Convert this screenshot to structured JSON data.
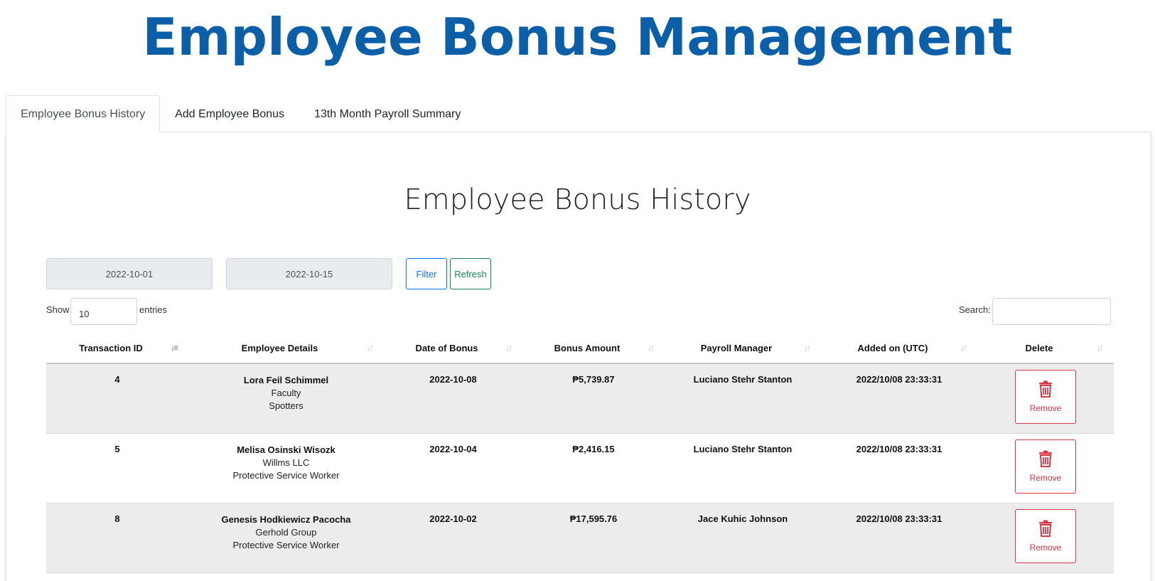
{
  "app": {
    "title": "Employee Bonus Management"
  },
  "tabs": [
    {
      "label": "Employee Bonus History",
      "active": true
    },
    {
      "label": "Add Employee Bonus",
      "active": false
    },
    {
      "label": "13th Month Payroll Summary",
      "active": false
    }
  ],
  "section": {
    "title": "Employee Bonus History"
  },
  "filters": {
    "date_from": "2022-10-01",
    "date_to": "2022-10-15",
    "filter_label": "Filter",
    "refresh_label": "Refresh"
  },
  "table_controls": {
    "show_label": "Show",
    "entries_value": "10",
    "entries_label": "entries",
    "search_label": "Search:",
    "search_value": ""
  },
  "columns": [
    {
      "label": "Transaction ID",
      "sorted": true
    },
    {
      "label": "Employee Details",
      "sorted": false
    },
    {
      "label": "Date of Bonus",
      "sorted": false
    },
    {
      "label": "Bonus Amount",
      "sorted": false
    },
    {
      "label": "Payroll Manager",
      "sorted": false
    },
    {
      "label": "Added on (UTC)",
      "sorted": false
    },
    {
      "label": "Delete",
      "sorted": false
    }
  ],
  "rows": [
    {
      "id": "4",
      "employee_name": "Lora Feil Schimmel",
      "employee_company": "Faculty",
      "employee_position": "Spotters",
      "date": "2022-10-08",
      "amount": "₱5,739.87",
      "manager": "Luciano Stehr Stanton",
      "added_on": "2022/10/08 23:33:31",
      "remove_label": "Remove"
    },
    {
      "id": "5",
      "employee_name": "Melisa Osinski Wisozk",
      "employee_company": "Willms LLC",
      "employee_position": "Protective Service Worker",
      "date": "2022-10-04",
      "amount": "₱2,416.15",
      "manager": "Luciano Stehr Stanton",
      "added_on": "2022/10/08 23:33:31",
      "remove_label": "Remove"
    },
    {
      "id": "8",
      "employee_name": "Genesis Hodkiewicz Pacocha",
      "employee_company": "Gerhold Group",
      "employee_position": "Protective Service Worker",
      "date": "2022-10-02",
      "amount": "₱17,595.76",
      "manager": "Jace Kuhic Johnson",
      "added_on": "2022/10/08 23:33:31",
      "remove_label": "Remove"
    }
  ],
  "colors": {
    "title": "#0b5ea8",
    "filter": "#0d6efd",
    "refresh": "#198754",
    "danger": "#dc3545",
    "stripe": "#ececec"
  },
  "icons": {
    "sort_active": "sort-numeric-down-icon",
    "sort": "sort-arrows-icon",
    "delete": "trash-icon"
  }
}
